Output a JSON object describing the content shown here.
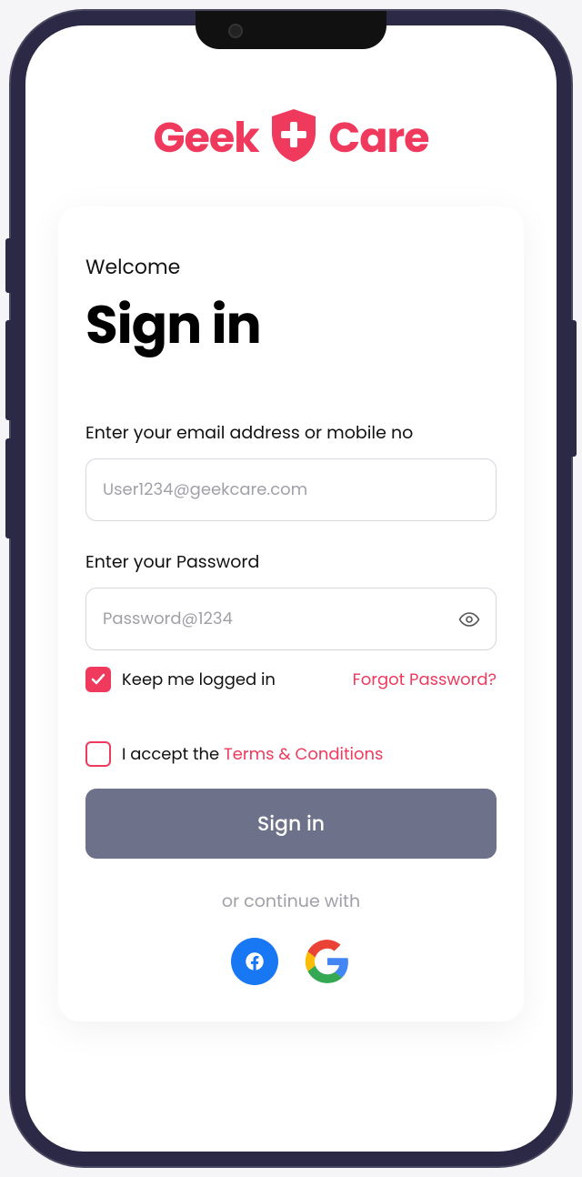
{
  "brand": {
    "word1": "Geek",
    "word2": "Care"
  },
  "welcome": "Welcome",
  "title": "Sign in",
  "emailLabel": "Enter your email address or mobile no",
  "emailPlaceholder": "User1234@geekcare.com",
  "passwordLabel": "Enter your Password",
  "passwordPlaceholder": "Password@1234",
  "keepLoggedIn": "Keep me logged in",
  "forgot": "Forgot Password?",
  "termsPrefix": "I accept the ",
  "termsLink": "Terms & Conditions",
  "signInButton": "Sign in",
  "continueWith": "or continue with"
}
